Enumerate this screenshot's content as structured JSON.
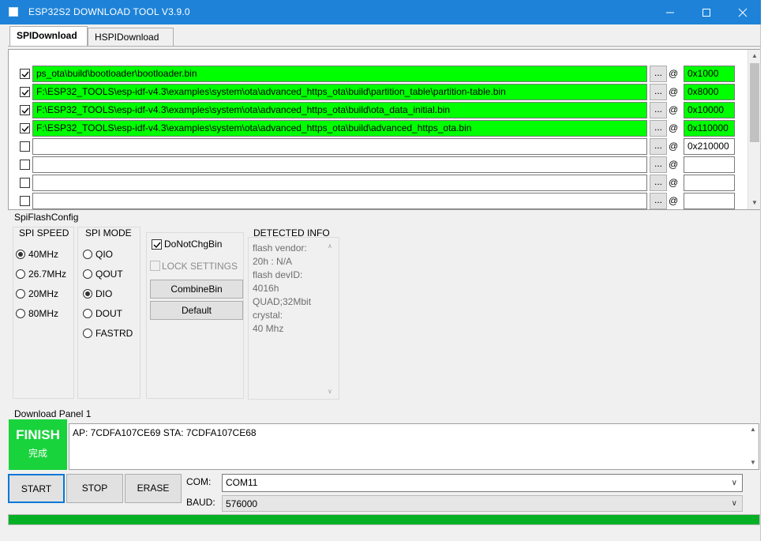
{
  "window": {
    "title": "ESP32S2 DOWNLOAD TOOL V3.9.0"
  },
  "tabs": [
    {
      "label": "SPIDownload"
    },
    {
      "label": "HSPIDownload"
    }
  ],
  "files": [
    {
      "checked": true,
      "path": "ps_ota\\build\\bootloader\\bootloader.bin",
      "browse": "...",
      "at": "@",
      "addr": "0x1000",
      "highlight": true
    },
    {
      "checked": true,
      "path": "F:\\ESP32_TOOLS\\esp-idf-v4.3\\examples\\system\\ota\\advanced_https_ota\\build\\partition_table\\partition-table.bin",
      "browse": "...",
      "at": "@",
      "addr": "0x8000",
      "highlight": true
    },
    {
      "checked": true,
      "path": "F:\\ESP32_TOOLS\\esp-idf-v4.3\\examples\\system\\ota\\advanced_https_ota\\build\\ota_data_initial.bin",
      "browse": "...",
      "at": "@",
      "addr": "0x10000",
      "highlight": true
    },
    {
      "checked": true,
      "path": "F:\\ESP32_TOOLS\\esp-idf-v4.3\\examples\\system\\ota\\advanced_https_ota\\build\\advanced_https_ota.bin",
      "browse": "...",
      "at": "@",
      "addr": "0x110000",
      "highlight": true
    },
    {
      "checked": false,
      "path": "",
      "browse": "...",
      "at": "@",
      "addr": "0x210000",
      "highlight": false
    },
    {
      "checked": false,
      "path": "",
      "browse": "...",
      "at": "@",
      "addr": "",
      "highlight": false
    },
    {
      "checked": false,
      "path": "",
      "browse": "...",
      "at": "@",
      "addr": "",
      "highlight": false
    },
    {
      "checked": false,
      "path": "",
      "browse": "...",
      "at": "@",
      "addr": "",
      "highlight": false
    }
  ],
  "spiflash": {
    "label": "SpiFlashConfig",
    "speed": {
      "label": "SPI SPEED",
      "options": [
        "40MHz",
        "26.7MHz",
        "20MHz",
        "80MHz"
      ],
      "selected": "40MHz"
    },
    "mode": {
      "label": "SPI MODE",
      "options": [
        "QIO",
        "QOUT",
        "DIO",
        "DOUT",
        "FASTRD"
      ],
      "selected": "DIO"
    },
    "do_not_chg_bin": {
      "label": "DoNotChgBin",
      "checked": true
    },
    "lock_settings": {
      "label": "LOCK SETTINGS",
      "checked": false
    },
    "combine_label": "CombineBin",
    "default_label": "Default",
    "detected": {
      "label": "DETECTED INFO",
      "lines": [
        "flash vendor:",
        "20h : N/A",
        "flash devID:",
        "4016h",
        "QUAD;32Mbit",
        "crystal:",
        "40 Mhz"
      ]
    }
  },
  "download_panel": {
    "label": "Download Panel 1",
    "status_big": "FINISH",
    "status_small": "完成",
    "status_color": "#19d33c",
    "message": "AP:  7CDFA107CE69  STA:  7CDFA107CE68",
    "start_label": "START",
    "stop_label": "STOP",
    "erase_label": "ERASE",
    "com_label": "COM:",
    "com_value": "COM11",
    "baud_label": "BAUD:",
    "baud_value": "576000",
    "progress": 1.0,
    "progress_color": "#06b025"
  }
}
